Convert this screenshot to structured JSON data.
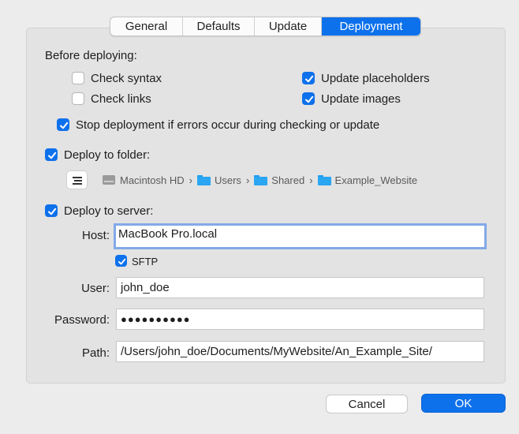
{
  "tabs": [
    {
      "label": "General",
      "active": false
    },
    {
      "label": "Defaults",
      "active": false
    },
    {
      "label": "Update",
      "active": false
    },
    {
      "label": "Deployment",
      "active": true
    }
  ],
  "before_deploying": {
    "heading": "Before deploying:",
    "check_syntax": {
      "label": "Check syntax",
      "checked": false
    },
    "check_links": {
      "label": "Check links",
      "checked": false
    },
    "update_placeholders": {
      "label": "Update placeholders",
      "checked": true
    },
    "update_images": {
      "label": "Update images",
      "checked": true
    },
    "stop_on_errors": {
      "label": "Stop deployment if errors occur during checking or update",
      "checked": true
    }
  },
  "deploy_folder": {
    "label": "Deploy to folder:",
    "checked": true,
    "path": [
      {
        "name": "Macintosh HD",
        "icon": "hard-drive-icon"
      },
      {
        "name": "Users",
        "icon": "folder-icon"
      },
      {
        "name": "Shared",
        "icon": "folder-icon"
      },
      {
        "name": "Example_Website",
        "icon": "folder-icon"
      }
    ]
  },
  "deploy_server": {
    "label": "Deploy to server:",
    "checked": true,
    "host_label": "Host:",
    "host_value": "MacBook Pro.local",
    "sftp_label": "SFTP",
    "sftp_checked": true,
    "user_label": "User:",
    "user_value": "john_doe",
    "password_label": "Password:",
    "password_value": "●●●●●●●●●●",
    "path_label": "Path:",
    "path_value": "/Users/john_doe/Documents/MyWebsite/An_Example_Site/"
  },
  "buttons": {
    "cancel": "Cancel",
    "ok": "OK"
  },
  "colors": {
    "accent": "#0e71ec",
    "focus_ring": "#83a9e9"
  }
}
